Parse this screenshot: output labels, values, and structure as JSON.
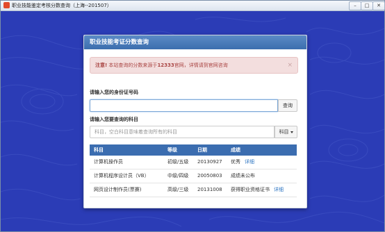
{
  "window": {
    "title": "职业技能鉴定考核分数查询（上海--201507）",
    "buttons": {
      "minimize": "–",
      "maximize": "□",
      "close": "✕"
    }
  },
  "panel": {
    "title": "职业技能考证分数查询",
    "alert": {
      "strong": "注意!",
      "text_before": " 本站查询的分数来源于",
      "highlight": "12333",
      "text_after": "官网，详情请到官网咨询",
      "close": "×"
    },
    "id_label": "请输入您的身份证号码",
    "id_value": "",
    "query_button": "查询",
    "subject_label": "请输入您要查询的科目",
    "subject_placeholder": "科目，空白科目意味着查询所有的科目",
    "subject_button": "科目"
  },
  "table": {
    "headers": [
      "科目",
      "等级",
      "日期",
      "成绩"
    ],
    "rows": [
      {
        "subject": "计算机操作员",
        "level": "初级/五级",
        "date": "20130927",
        "result": "优秀",
        "link": "详细"
      },
      {
        "subject": "计算机程序设计员（VB）",
        "level": "中级/四级",
        "date": "20050803",
        "result": "成绩未公布",
        "link": ""
      },
      {
        "subject": "网页设计制作员(票賽)",
        "level": "高级/三级",
        "date": "20131008",
        "result": "获得职业资格证书",
        "link": "详细"
      }
    ]
  },
  "colors": {
    "background": "#2b3cb6",
    "header": "#3c6eae",
    "alert_bg": "#f3dede",
    "alert_text": "#a94442",
    "link": "#2f76c2"
  },
  "icons": [
    "app-icon",
    "caret-down-icon",
    "close-icon"
  ]
}
